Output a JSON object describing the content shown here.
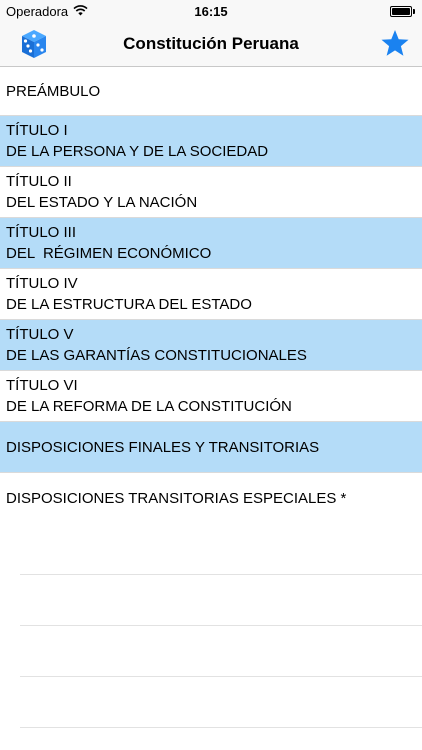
{
  "status_bar": {
    "carrier": "Operadora",
    "time": "16:15"
  },
  "nav": {
    "title": "Constitución Peruana"
  },
  "colors": {
    "accent": "#1a82f0",
    "highlight": "#b4dcf8"
  },
  "list": {
    "items": [
      {
        "line1": "PREÁMBULO",
        "line2": "",
        "highlighted": false
      },
      {
        "line1": "TÍTULO I",
        "line2": "DE LA PERSONA Y DE LA SOCIEDAD",
        "highlighted": true
      },
      {
        "line1": "TÍTULO II",
        "line2": "DEL ESTADO Y LA NACIÓN",
        "highlighted": false
      },
      {
        "line1": "TÍTULO III",
        "line2": "DEL  RÉGIMEN ECONÓMICO",
        "highlighted": true
      },
      {
        "line1": "TÍTULO IV",
        "line2": "DE LA ESTRUCTURA DEL ESTADO",
        "highlighted": false
      },
      {
        "line1": "TÍTULO V",
        "line2": "DE LAS GARANTÍAS CONSTITUCIONALES",
        "highlighted": true
      },
      {
        "line1": "TÍTULO VI",
        "line2": "DE LA REFORMA DE LA CONSTITUCIÓN",
        "highlighted": false
      },
      {
        "line1": "DISPOSICIONES FINALES Y TRANSITORIAS",
        "line2": "",
        "highlighted": true
      },
      {
        "line1": "DISPOSICIONES TRANSITORIAS ESPECIALES *",
        "line2": "",
        "highlighted": false
      }
    ]
  }
}
